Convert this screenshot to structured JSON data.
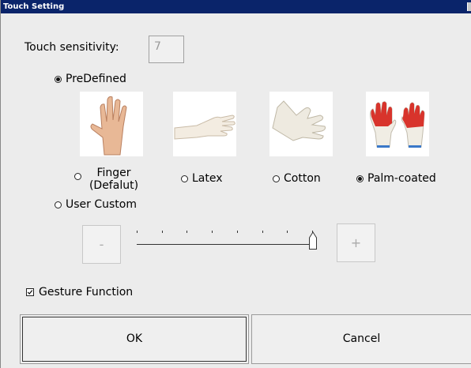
{
  "window": {
    "title": "Touch Setting"
  },
  "sensitivity": {
    "label": "Touch sensitivity:",
    "value": "7"
  },
  "modes": {
    "predefined": {
      "label": "PreDefined",
      "selected": true
    },
    "user_custom": {
      "label": "User Custom",
      "selected": false
    }
  },
  "glove_options": [
    {
      "label_line1": "Finger",
      "label_line2": "(Defalut)",
      "icon": "bare-hand-icon",
      "selected": false
    },
    {
      "label": "Latex",
      "icon": "latex-glove-icon",
      "selected": false
    },
    {
      "label": "Cotton",
      "icon": "cotton-glove-icon",
      "selected": false
    },
    {
      "label": "Palm-coated",
      "icon": "palm-coated-glove-icon",
      "selected": true
    }
  ],
  "custom_slider": {
    "minus_label": "-",
    "plus_label": "+",
    "tick_count": 8,
    "level_fraction": 1.0
  },
  "gesture": {
    "label": "Gesture Function",
    "checked": true
  },
  "buttons": {
    "ok": "OK",
    "cancel": "Cancel"
  },
  "colors": {
    "titlebar": "#0a246a",
    "glove_red": "#d8342c"
  }
}
